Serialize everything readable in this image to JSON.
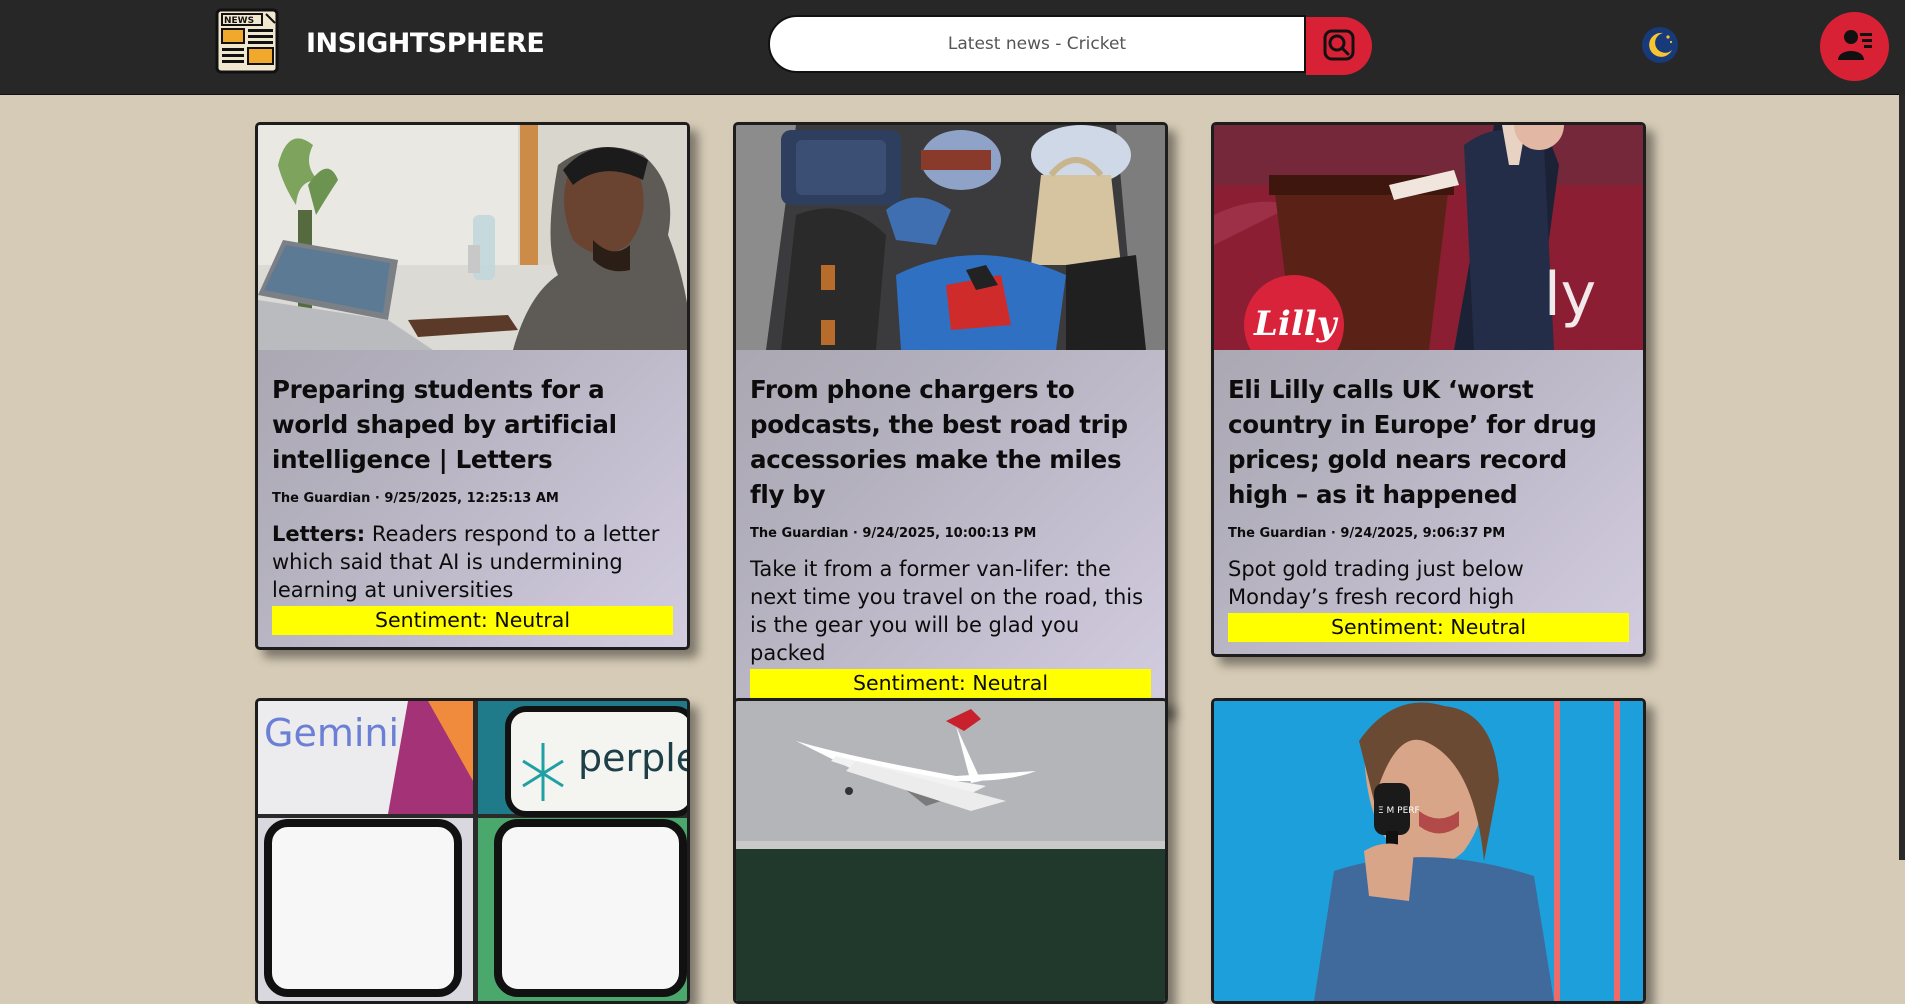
{
  "app": {
    "title": "INSIGHTSPHERE",
    "logo_icon": "newspaper-icon",
    "search": {
      "placeholder": "Latest news - Cricket",
      "button_icon": "search-icon"
    },
    "theme_toggle_icon": "moon-icon",
    "profile_icon": "user-profile-icon"
  },
  "colors": {
    "header": "#272727",
    "accent": "#d92135",
    "background": "#d6cbb6",
    "sentiment_neutral": "#ffff00"
  },
  "articles": [
    {
      "title": "Preparing students for a world shaped by artificial intelligence | Letters",
      "meta": "The Guardian · 9/25/2025, 12:25:13 AM",
      "desc_label": "Letters:",
      "desc": " Readers respond to a letter which said that AI is undermining learning at universities",
      "sentiment": "Sentiment: Neutral"
    },
    {
      "title": "From phone chargers to podcasts, the best road trip accessories make the miles fly by",
      "meta": "The Guardian · 9/24/2025, 10:00:13 PM",
      "desc": "Take it from a former van-lifer: the next time you travel on the road, this is the gear you will be glad you packed",
      "sentiment": "Sentiment: Neutral"
    },
    {
      "title": "Eli Lilly calls UK ‘worst country in Europe’ for drug prices; gold nears record high – as it happened",
      "meta": "The Guardian · 9/24/2025, 9:06:37 PM",
      "desc": "Spot gold trading just below Monday’s fresh record high",
      "sentiment": "Sentiment: Neutral",
      "image_text": "Lilly"
    },
    {
      "image_text_1": "Gemini",
      "image_text_2": "perplex"
    },
    {},
    {
      "image_text": "Ξ M PERF"
    }
  ]
}
